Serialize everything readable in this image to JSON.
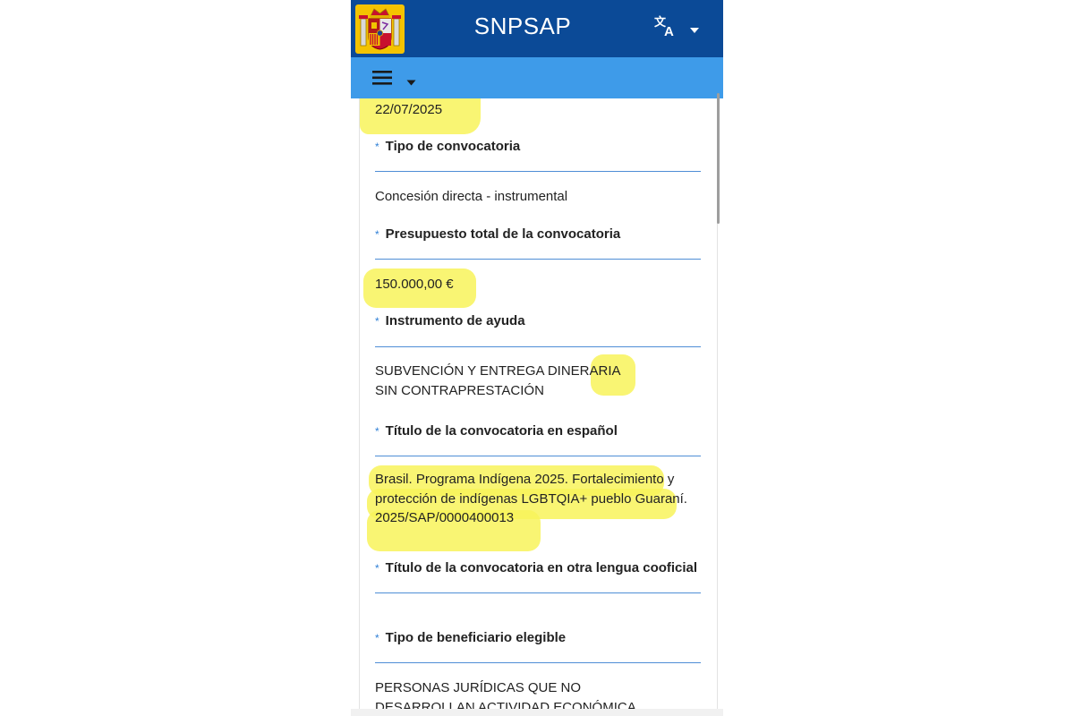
{
  "app": {
    "title": "SNPSAP",
    "accent_color": "#0b4a97",
    "subbar_color": "#3e9be9",
    "highlight_color": "#f8f35a"
  },
  "icons": {
    "crest": "spain-coat-of-arms-icon",
    "translate": "translate-icon",
    "lang_caret": "caret-down-icon",
    "menu": "hamburger-menu-icon",
    "menu_caret": "caret-down-icon"
  },
  "form": {
    "date_value": "22/07/2025",
    "tipo_label": "Tipo de convocatoria",
    "tipo_value": "Concesión directa - instrumental",
    "presupuesto_label": "Presupuesto total de la convocatoria",
    "presupuesto_value": "150.000,00 €",
    "instrumento_label": "Instrumento de ayuda",
    "instrumento_value": "SUBVENCIÓN Y ENTREGA DINERARIA SIN CONTRAPRESTACIÓN",
    "titulo_es_label": "Título de la convocatoria en español",
    "titulo_es_value": "Brasil. Programa Indígena 2025. Fortalecimiento y protección de indígenas LGBTQIA+ pueblo Guaraní. 2025/SAP/0000400013",
    "titulo_cooficial_label": "Título de la convocatoria en otra lengua cooficial",
    "titulo_cooficial_value": "",
    "beneficiario_label": "Tipo de beneficiario elegible",
    "beneficiario_value": "PERSONAS JURÍDICAS QUE NO DESARROLLAN ACTIVIDAD ECONÓMICA",
    "required_marker": "*"
  }
}
